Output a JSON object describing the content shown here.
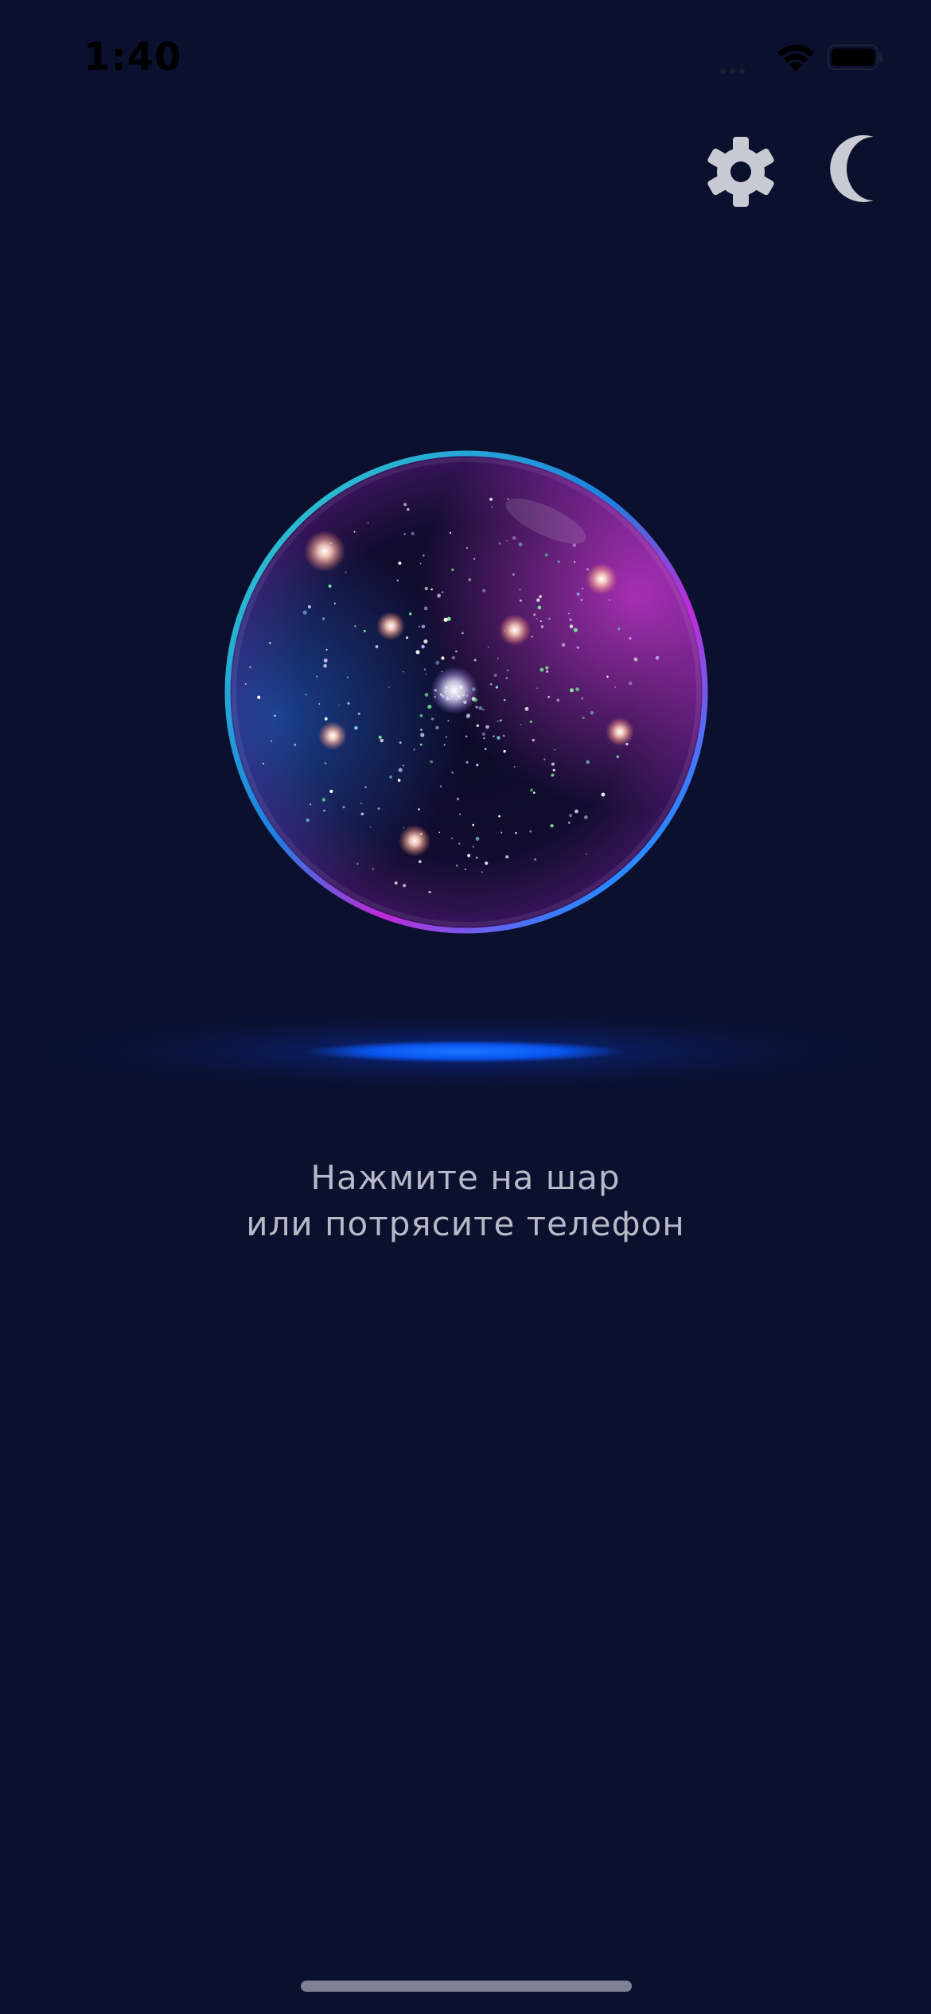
{
  "status_bar": {
    "time": "1:40",
    "wifi_icon": "wifi-icon",
    "battery_icon": "battery-icon"
  },
  "toolbar": {
    "settings_icon": "gear-icon",
    "night_mode_icon": "moon-icon"
  },
  "orb": {
    "icon": "crystal-ball"
  },
  "prompt": {
    "line1": "Нажмите на шар",
    "line2": "или потрясите телефон"
  },
  "colors": {
    "background": "#0a102e",
    "icon": "#c9cad3",
    "text": "#b7b9c9",
    "glow": "#0a5cff",
    "orb_rim_cyan": "#2fd6c8",
    "orb_rim_magenta": "#c02bd6"
  }
}
